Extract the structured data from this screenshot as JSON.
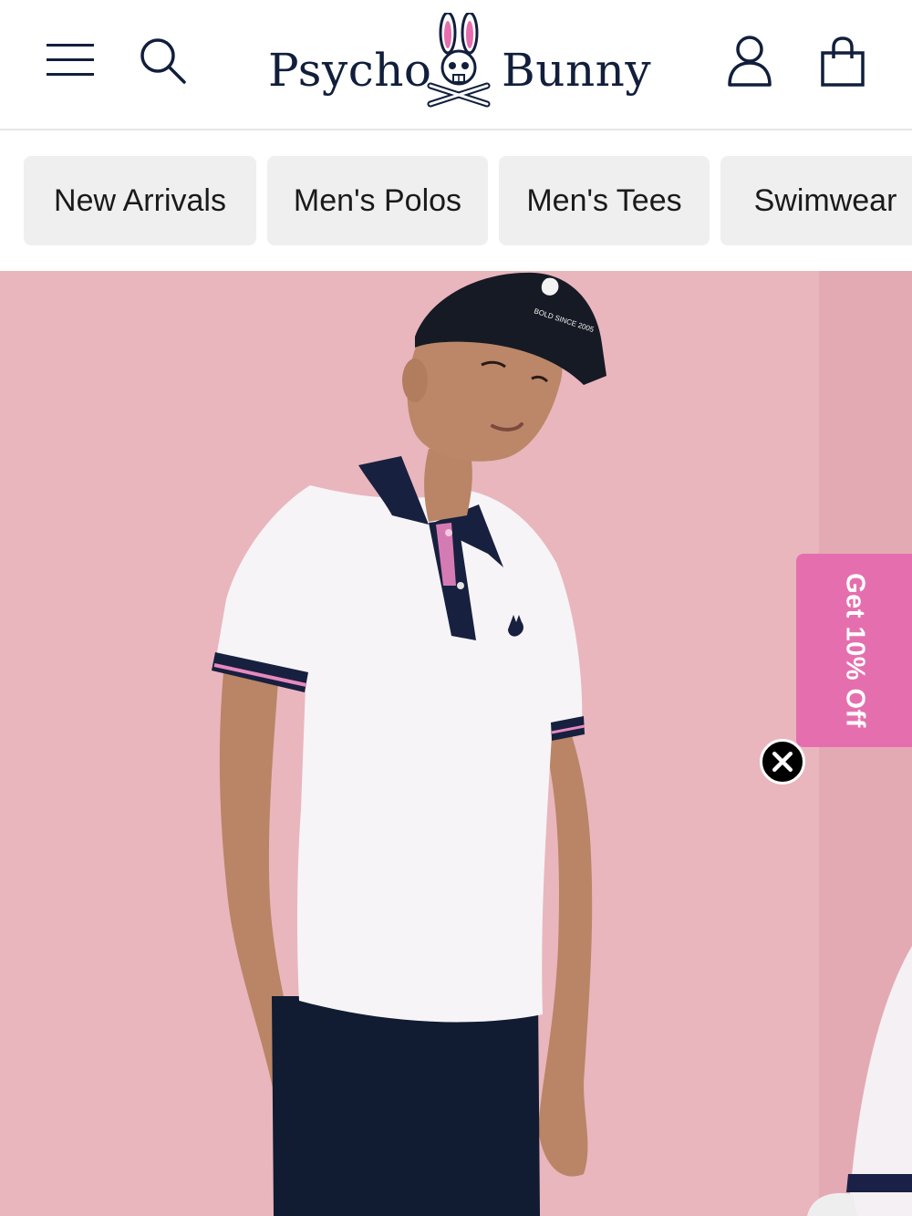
{
  "header": {
    "brand_left": "Psycho",
    "brand_right": "Bunny",
    "icons": {
      "menu": "hamburger-menu-icon",
      "search": "search-icon",
      "account": "account-icon",
      "bag": "shopping-bag-icon"
    }
  },
  "categories": [
    {
      "label": "New Arrivals"
    },
    {
      "label": "Men's Polos"
    },
    {
      "label": "Men's Tees"
    },
    {
      "label": "Swimwear"
    }
  ],
  "hero": {
    "background_color": "#e9b6bd",
    "cap_embroidery": "BOLD SINCE 2005"
  },
  "promo": {
    "label": "Get 10% Off",
    "color": "#e56fae",
    "close_icon": "close-icon"
  },
  "colors": {
    "navy": "#111f3c",
    "chip_bg": "#efefef"
  }
}
